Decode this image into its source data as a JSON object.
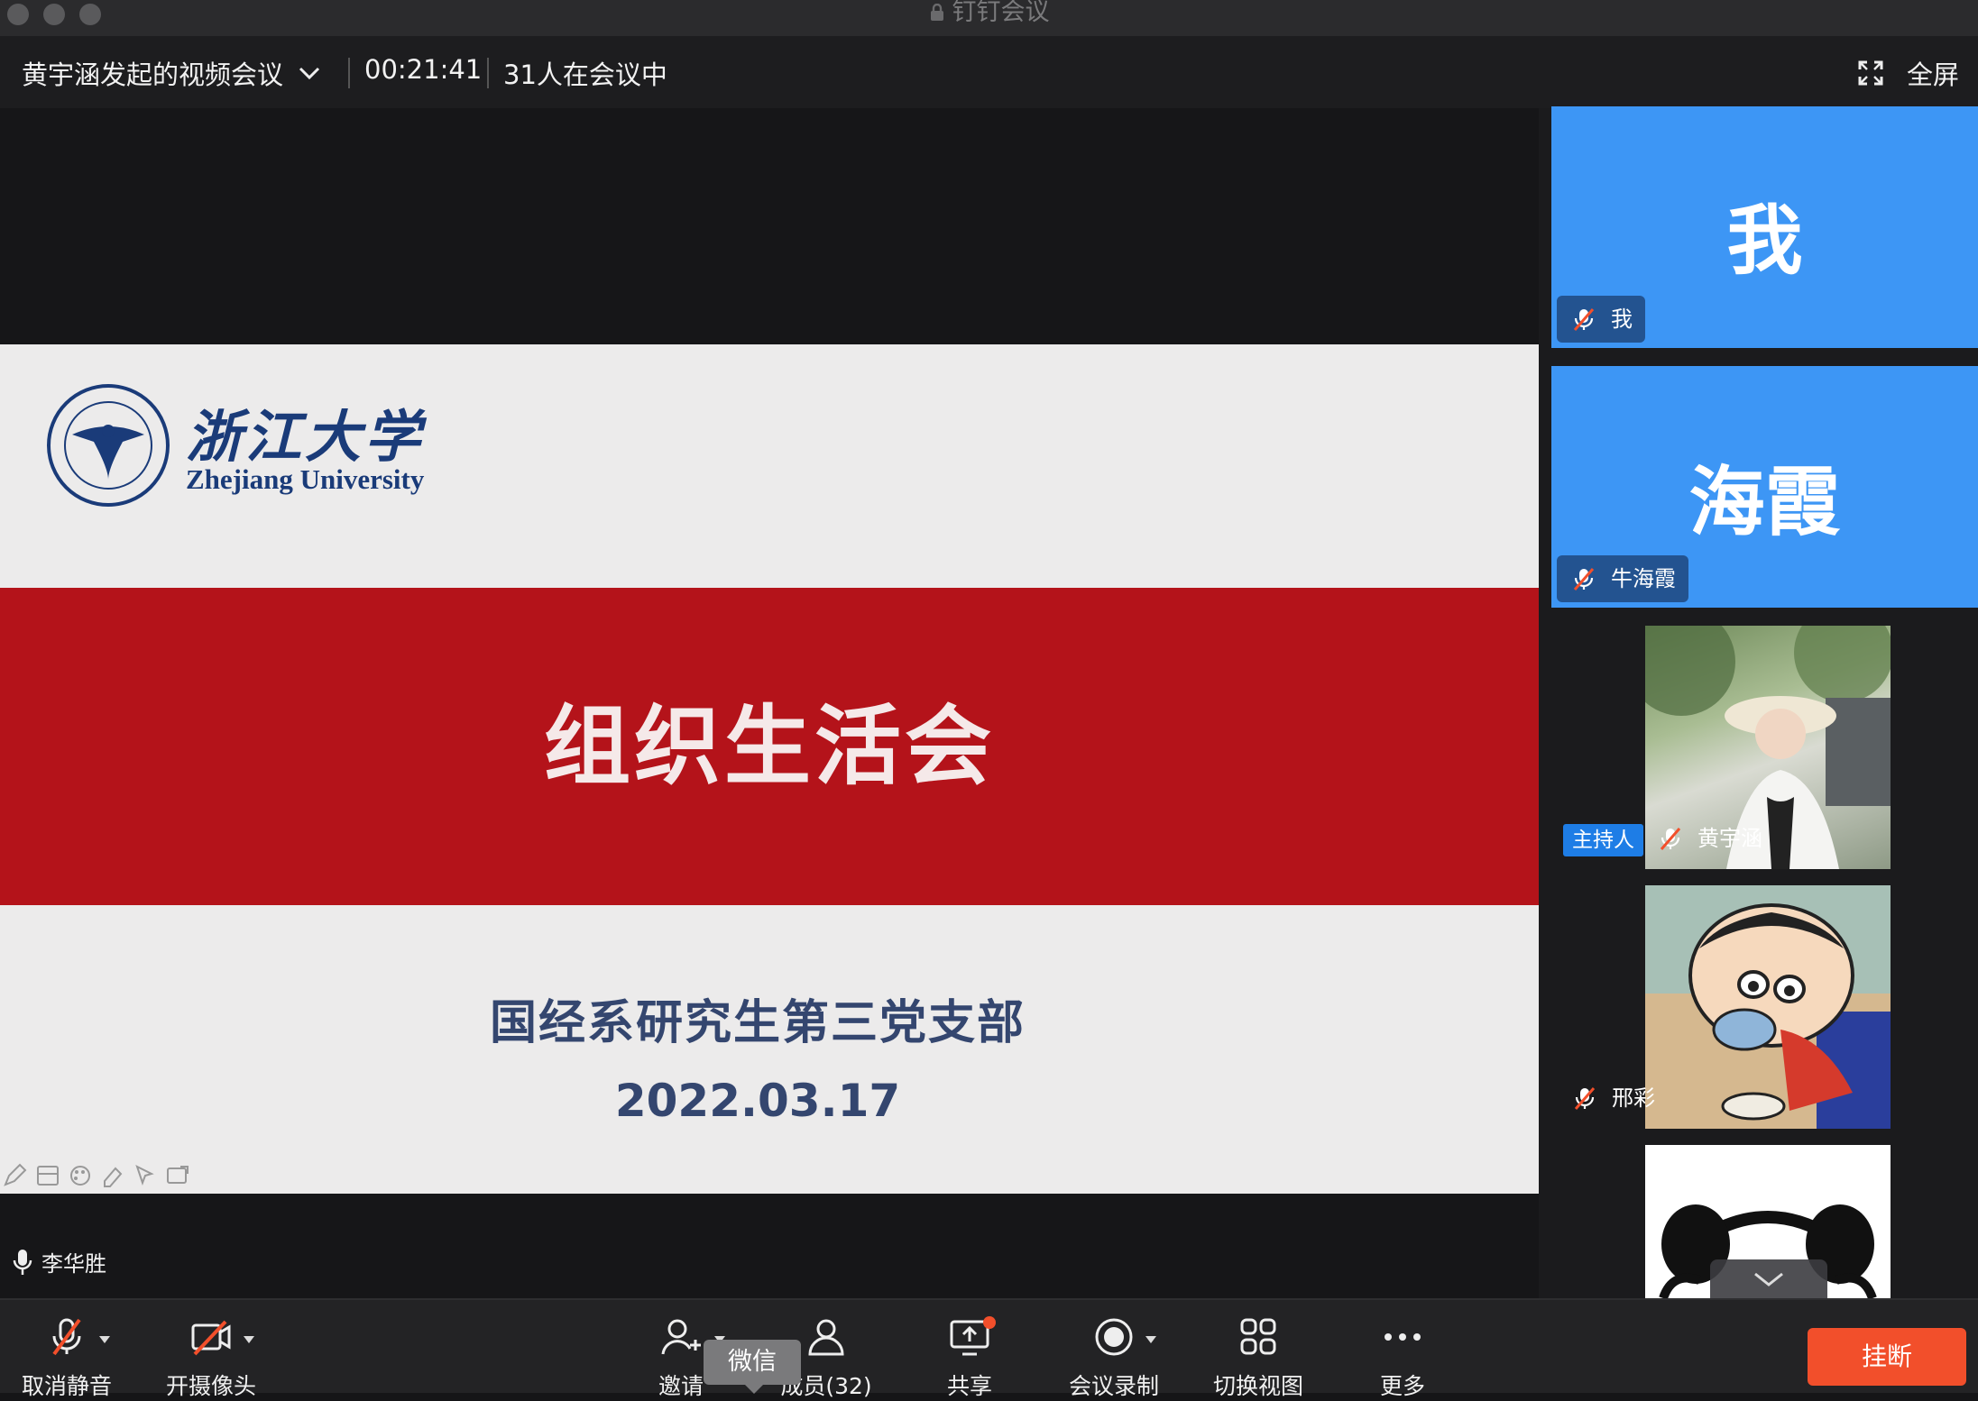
{
  "window": {
    "title": "钉钉会议"
  },
  "header": {
    "meeting_title": "黄宇涵发起的视频会议",
    "timer": "00:21:41",
    "participant_status": "31人在会议中",
    "fullscreen_label": "全屏"
  },
  "slide": {
    "university_cn": "浙江大学",
    "university_en": "Zhejiang University",
    "title": "组织生活会",
    "organization": "国经系研究生第三党支部",
    "date": "2022.03.17"
  },
  "main_speaker": {
    "name": "李华胜"
  },
  "participants": [
    {
      "avatar_text": "我",
      "name": "我",
      "muted": true
    },
    {
      "avatar_text": "海霞",
      "name": "牛海霞",
      "muted": true
    },
    {
      "name": "黄宇涵",
      "role": "主持人",
      "muted": true
    },
    {
      "name": "邢彩",
      "muted": true
    }
  ],
  "toolbar": {
    "unmute_label": "取消静音",
    "camera_label": "开摄像头",
    "invite_label": "邀请",
    "members_label": "成员(32)",
    "share_label": "共享",
    "record_label": "会议录制",
    "view_label": "切换视图",
    "more_label": "更多",
    "hangup_label": "挂断",
    "tooltip": "微信"
  },
  "colors": {
    "accent_blue": "#3d96f5",
    "slide_red": "#b4131a",
    "hangup_orange": "#f24f2b",
    "host_badge": "#1e7de6"
  }
}
